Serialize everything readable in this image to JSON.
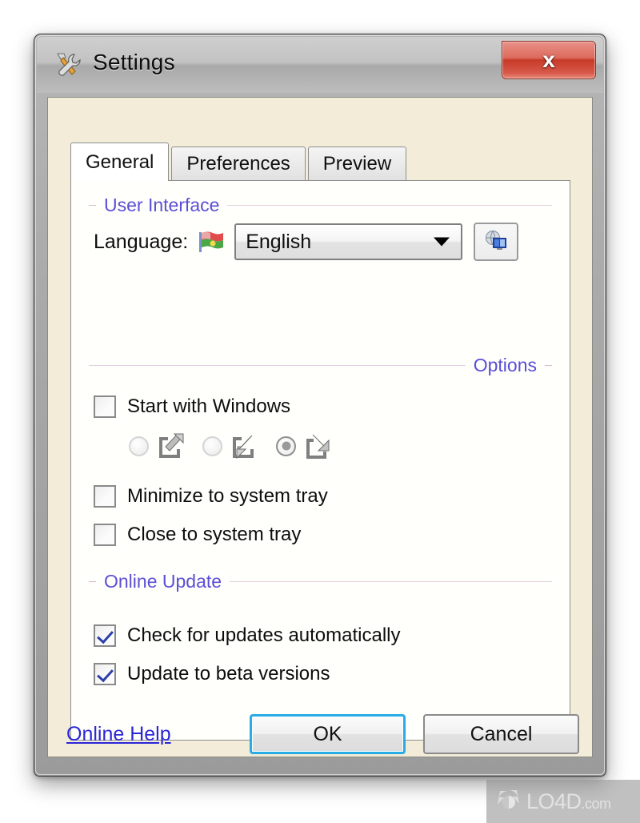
{
  "window": {
    "title": "Settings",
    "title_icon": "wrench-hammer-icon",
    "close_label": "x"
  },
  "tabs": [
    {
      "label": "General",
      "active": true
    },
    {
      "label": "Preferences",
      "active": false
    },
    {
      "label": "Preview",
      "active": false
    }
  ],
  "groups": {
    "user_interface": {
      "title": "User Interface",
      "align": "left"
    },
    "options": {
      "title": "Options",
      "align": "right"
    },
    "online_update": {
      "title": "Online Update",
      "align": "left"
    }
  },
  "language": {
    "label": "Language:",
    "flag_icon": "flag-icon",
    "selected": "English",
    "options": [
      "English"
    ],
    "download_button_icon": "globe-monitor-icon"
  },
  "options": {
    "start_with_windows": {
      "label": "Start with Windows",
      "checked": false
    },
    "startup_modes": [
      {
        "icon": "arrow-out-box-icon",
        "selected": false
      },
      {
        "icon": "arrow-in-box-icon",
        "selected": false
      },
      {
        "icon": "arrow-down-right-box-icon",
        "selected": true
      }
    ],
    "minimize_to_tray": {
      "label": "Minimize to system tray",
      "checked": false
    },
    "close_to_tray": {
      "label": "Close to system tray",
      "checked": false
    }
  },
  "online_update": {
    "check_automatically": {
      "label": "Check for updates automatically",
      "checked": true
    },
    "beta_versions": {
      "label": "Update to beta versions",
      "checked": true
    }
  },
  "footer": {
    "help_link": "Online Help",
    "ok_label": "OK",
    "cancel_label": "Cancel"
  },
  "watermark": {
    "brand": "LO4D",
    "suffix": ".com",
    "icon": "refresh-circle-icon"
  },
  "colors": {
    "accent_link": "#2b26d8",
    "group_title": "#5b4fd6",
    "focus_ring": "#29ace4",
    "close_button": "#c73a27",
    "client_bg": "#f2ecd8",
    "panel_bg": "#fffffb"
  }
}
